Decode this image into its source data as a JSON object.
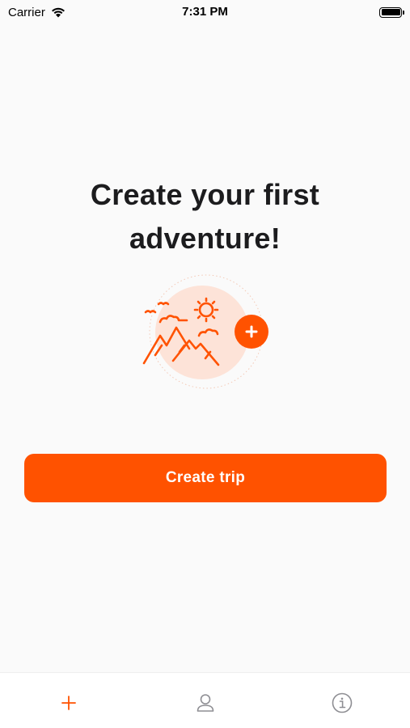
{
  "status_bar": {
    "carrier": "Carrier",
    "time": "7:31 PM"
  },
  "main": {
    "headline_line1": "Create your first",
    "headline_line2": "adventure!",
    "illustration_icon": "mountains-sun-birds-illustration",
    "add_icon": "plus-badge-icon",
    "create_button_label": "Create trip"
  },
  "tab_bar": {
    "tabs": [
      {
        "icon": "plus-icon",
        "selected": true
      },
      {
        "icon": "person-icon",
        "selected": false
      },
      {
        "icon": "info-icon",
        "selected": false
      }
    ]
  },
  "colors": {
    "accent": "#ff5200",
    "illustration_bg": "#fde3d8",
    "tab_inactive": "#8e8e93",
    "background": "#fafafa"
  }
}
